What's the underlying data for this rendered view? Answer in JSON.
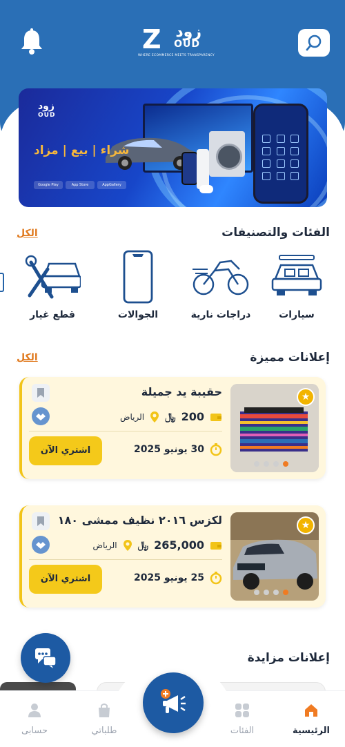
{
  "header": {
    "logo_ar": "زود",
    "logo_en": "OUD",
    "logo_letter": "Z",
    "tagline": "WHERE ECOMMERCE MEETS TRANSPARENCY"
  },
  "banner": {
    "logo_ar": "زود",
    "logo_en": "OUD",
    "slogan": "شراء | بيع | مزاد",
    "stores": [
      "Google Play",
      "App Store",
      "AppGallery"
    ]
  },
  "categories": {
    "title": "الفئات والتصنيفات",
    "see_all": "الكل",
    "items": [
      {
        "label": "سيارات",
        "icon": "car-icon"
      },
      {
        "label": "دراجات نارية",
        "icon": "motorcycle-icon"
      },
      {
        "label": "الجوالات",
        "icon": "phone-icon"
      },
      {
        "label": "قطع غيار",
        "icon": "spare-parts-icon"
      }
    ]
  },
  "featured": {
    "title": "إعلانات مميزة",
    "see_all": "الكل",
    "ads": [
      {
        "title": "حقيبة يد جميلة",
        "price": "200",
        "currency": "﷼",
        "city": "الرياض",
        "date": "30 يونيو 2025",
        "buy_label": "اشتري الآن"
      },
      {
        "title": "لكزس ٢٠١٦ نظيف ممشى ١٨٠ م...",
        "price": "265,000",
        "currency": "﷼",
        "city": "الرياض",
        "date": "25 يونيو 2025",
        "buy_label": "اشتري الآن"
      }
    ]
  },
  "auctions": {
    "title": "إعلانات مزايدة"
  },
  "nav": {
    "home": "الرئيسية",
    "categories": "الفئات",
    "orders": "طلباتي",
    "account": "حسابى"
  },
  "colors": {
    "primary": "#2a6fb6",
    "accent": "#f4c91a",
    "orange": "#e07a1f"
  }
}
